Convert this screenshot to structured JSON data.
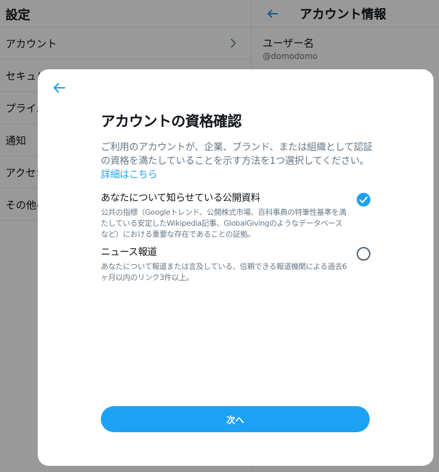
{
  "background": {
    "left_header": "設定",
    "menu_items": [
      {
        "label": "アカウント"
      },
      {
        "label": "セキュリ"
      },
      {
        "label": "プライバ"
      },
      {
        "label": "通知"
      },
      {
        "label": "アクセシ"
      },
      {
        "label": "その他の"
      }
    ],
    "right_header": "アカウント情報",
    "info": {
      "label": "ユーザー名",
      "value": "@domodomo"
    }
  },
  "modal": {
    "title": "アカウントの資格確認",
    "description": "ご利用のアカウントが、企業、ブランド、または組織として認証の資格を満たしていることを示す方法を1つ選択してください。",
    "learn_more": "詳細はこちら",
    "options": [
      {
        "title": "あなたについて知らせている公開資料",
        "description": "公共の指標（Googleトレンド、公開株式市場、百科事典の特筆性基準を満たしている安定したWikipedia記事、GlobalGivingのようなデータベースなど）における重要な存在であることの証拠。",
        "selected": true
      },
      {
        "title": "ニュース報道",
        "description": "あなたについて報道または言及している、信頼できる報道機関による過去6ヶ月以内のリンク3件以上。",
        "selected": false
      }
    ],
    "next_label": "次へ"
  },
  "colors": {
    "accent": "#1da1f2",
    "muted": "#657786",
    "text": "#0f1419"
  },
  "icons": {
    "back": "arrow-left-icon",
    "chevron": "chevron-right-icon",
    "check": "check-icon"
  }
}
